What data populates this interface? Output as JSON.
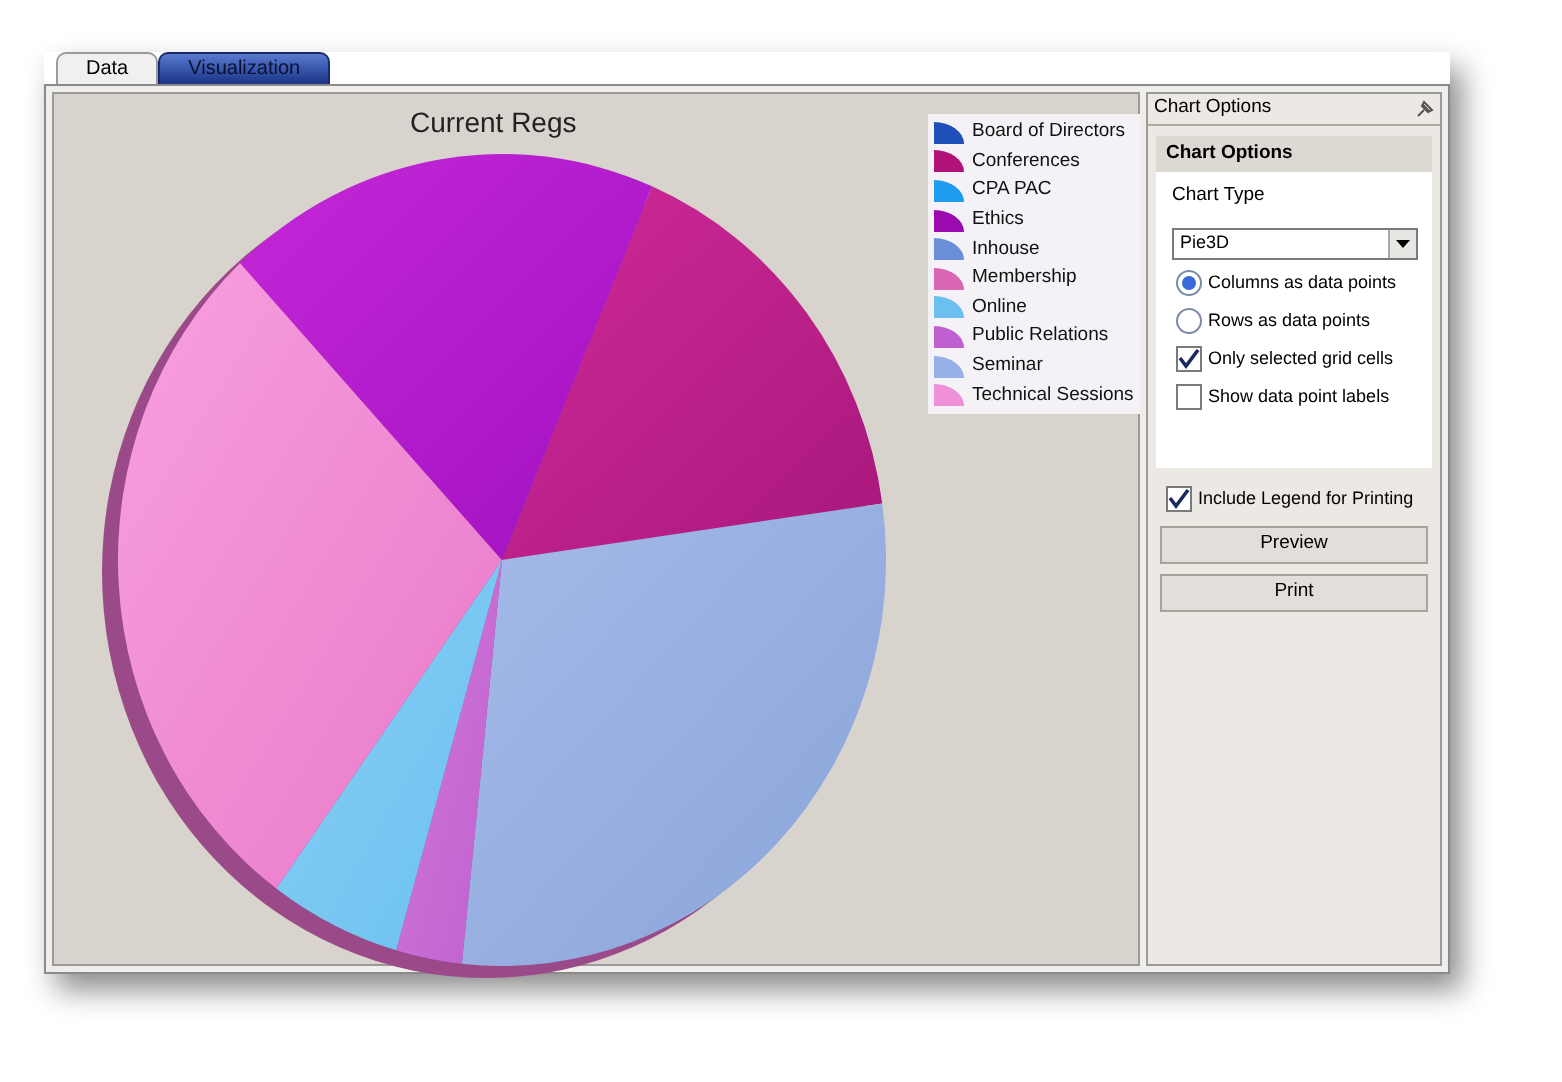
{
  "tabs": [
    {
      "label": "Data",
      "selected": false
    },
    {
      "label": "Visualization",
      "selected": true
    }
  ],
  "chart": {
    "title": "Current Regs",
    "legend": [
      {
        "label": "Board of Directors",
        "color": "#1f4fb8"
      },
      {
        "label": "Conferences",
        "color": "#b0127a"
      },
      {
        "label": "CPA PAC",
        "color": "#1e9cf0"
      },
      {
        "label": "Ethics",
        "color": "#9a0aae"
      },
      {
        "label": "Inhouse",
        "color": "#6a8fd8"
      },
      {
        "label": "Membership",
        "color": "#d866b4"
      },
      {
        "label": "Online",
        "color": "#6cc0f0"
      },
      {
        "label": "Public Relations",
        "color": "#c060d0"
      },
      {
        "label": "Seminar",
        "color": "#98b0e8"
      },
      {
        "label": "Technical Sessions",
        "color": "#f090d8"
      }
    ]
  },
  "options_panel": {
    "header": "Chart Options",
    "group_title": "Chart Options",
    "chart_type_label": "Chart Type",
    "chart_type_value": "Pie3D",
    "options": [
      {
        "kind": "radio",
        "label": "Columns as data points",
        "selected": true
      },
      {
        "kind": "radio",
        "label": "Rows as data points",
        "selected": false
      },
      {
        "kind": "checkbox",
        "label": "Only selected grid cells",
        "checked": true
      },
      {
        "kind": "checkbox",
        "label": "Show data point labels",
        "checked": false
      }
    ],
    "include_legend": {
      "label": "Include Legend for Printing",
      "checked": true
    },
    "buttons": [
      "Preview",
      "Print"
    ]
  }
}
